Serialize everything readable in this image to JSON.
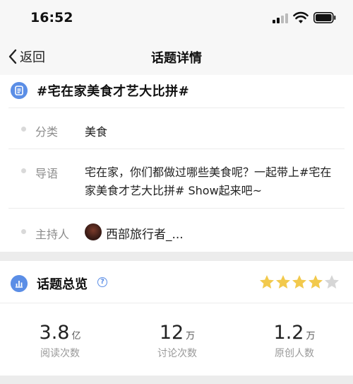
{
  "status": {
    "time": "16:52"
  },
  "nav": {
    "back_label": "返回",
    "title": "话题详情"
  },
  "topic": {
    "title": "#宅在家美食才艺大比拼#",
    "rows": [
      {
        "label": "分类",
        "value": "美食"
      },
      {
        "label": "导语",
        "value": "宅在家，你们都做过哪些美食呢？一起带上#宅在家美食才艺大比拼# Show起来吧~"
      },
      {
        "label": "主持人",
        "value": "西部旅行者_..."
      }
    ]
  },
  "overview": {
    "title": "话题总览",
    "rating": 4,
    "rating_max": 5,
    "star_color": "#f2c94c",
    "star_empty_color": "#d6d6d6",
    "stats": [
      {
        "value": "3.8",
        "unit": "亿",
        "label": "阅读次数"
      },
      {
        "value": "12",
        "unit": "万",
        "label": "讨论次数"
      },
      {
        "value": "1.2",
        "unit": "万",
        "label": "原创人数"
      }
    ]
  },
  "colors": {
    "accent": "#5b8ee6"
  }
}
